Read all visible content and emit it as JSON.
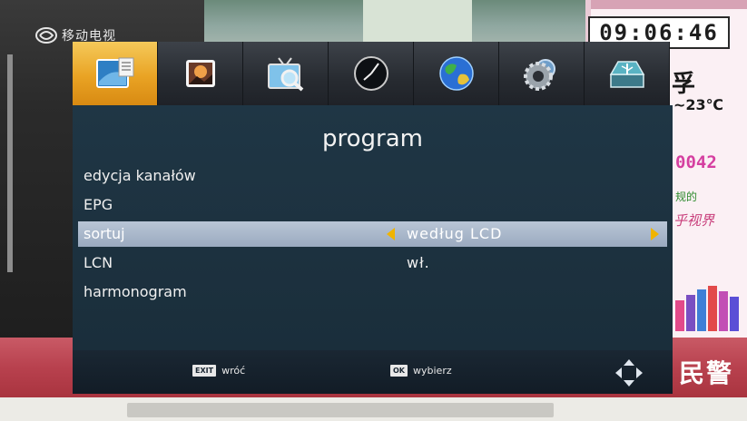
{
  "background": {
    "channel_logo_text": "移动电视",
    "clock": "09:06:46",
    "right_panel": {
      "char": "孚",
      "temperature": "~23℃",
      "number": "0042",
      "green_text": "规的",
      "pink_text": "乎视界"
    },
    "bottom_red_text": "民警"
  },
  "menu": {
    "tabs": [
      {
        "icon": "program-icon",
        "active": true
      },
      {
        "icon": "picture-icon",
        "active": false
      },
      {
        "icon": "channel-search-icon",
        "active": false
      },
      {
        "icon": "clock-icon",
        "active": false
      },
      {
        "icon": "globe-icon",
        "active": false
      },
      {
        "icon": "settings-gear-icon",
        "active": false
      },
      {
        "icon": "usb-icon",
        "active": false
      }
    ],
    "title": "program",
    "rows": [
      {
        "label": "edycja kanałów",
        "value": ""
      },
      {
        "label": "EPG",
        "value": ""
      },
      {
        "label": "sortuj",
        "value": "według LCD",
        "selected": true
      },
      {
        "label": "LCN",
        "value": "wł."
      },
      {
        "label": "harmonogram",
        "value": ""
      }
    ],
    "footer": {
      "exit_key": "EXIT",
      "exit_label": "wróć",
      "ok_key": "OK",
      "ok_label": "wybierz"
    }
  },
  "colors": {
    "active_tab": "#e9a324",
    "panel_bg": "#1f3645",
    "selected_row": "#aab8ca",
    "arrow": "#f0b400"
  }
}
